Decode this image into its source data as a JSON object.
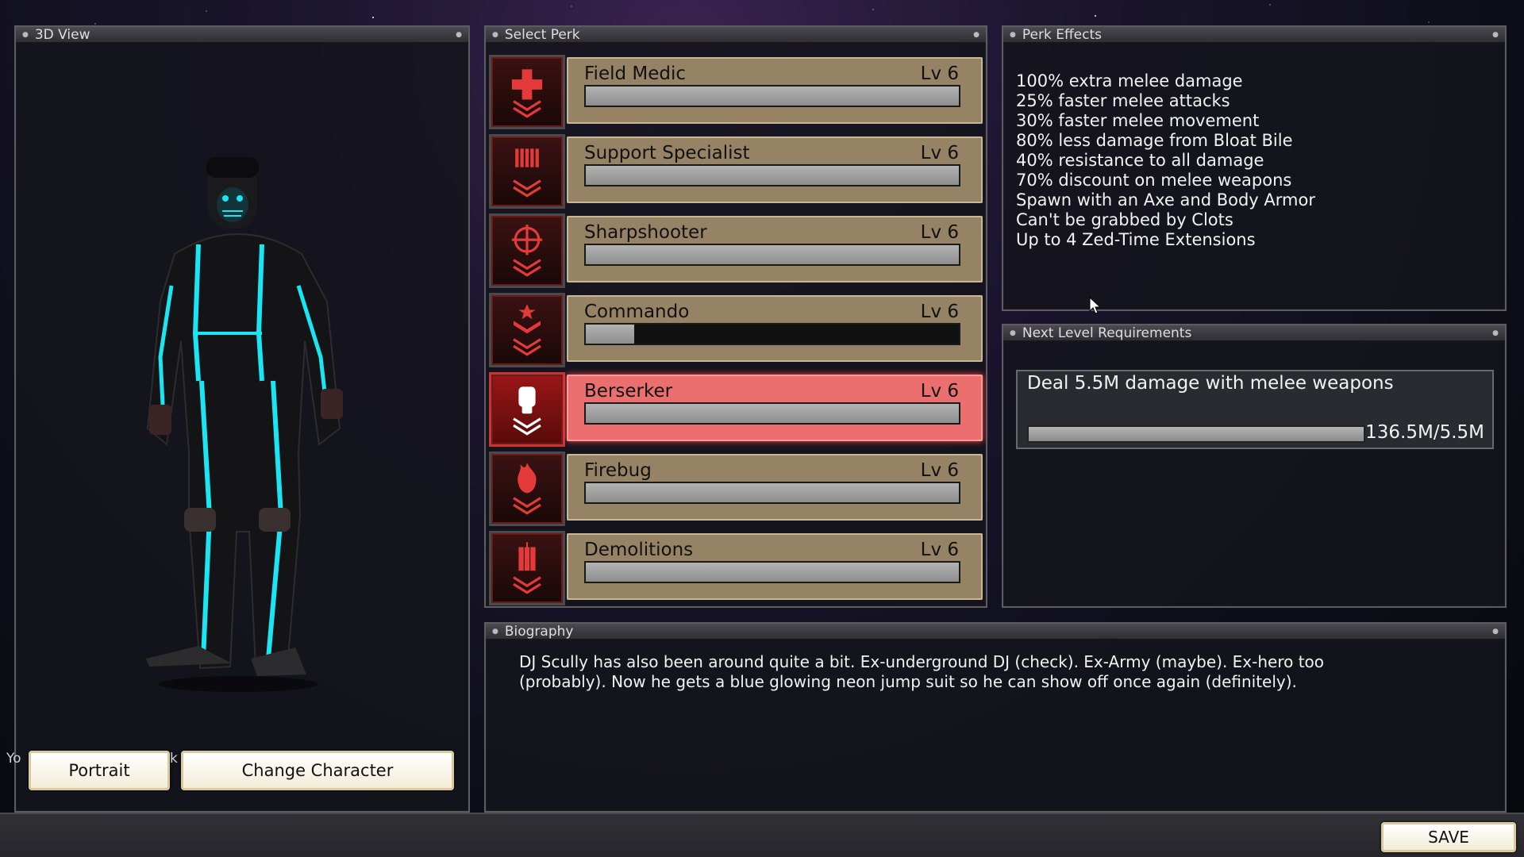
{
  "panels": {
    "view3d": "3D View",
    "select_perk": "Select Perk",
    "perk_effects": "Perk Effects",
    "next_level": "Next Level Requirements",
    "biography": "Biography"
  },
  "view3d": {
    "portrait_label": "Portrait",
    "change_character_label": "Change Character",
    "left_edge_text": "Yo",
    "mid_edge_text": "k"
  },
  "perks": [
    {
      "name": "Field Medic",
      "level": "Lv 6",
      "progress": 1.0,
      "icon": "medic-cross-icon",
      "selected": false
    },
    {
      "name": "Support Specialist",
      "level": "Lv 6",
      "progress": 1.0,
      "icon": "shells-icon",
      "selected": false
    },
    {
      "name": "Sharpshooter",
      "level": "Lv 6",
      "progress": 1.0,
      "icon": "crosshair-icon",
      "selected": false
    },
    {
      "name": "Commando",
      "level": "Lv 6",
      "progress": 0.13,
      "icon": "star-chevrons-icon",
      "selected": false
    },
    {
      "name": "Berserker",
      "level": "Lv 6",
      "progress": 1.0,
      "icon": "fist-icon",
      "selected": true
    },
    {
      "name": "Firebug",
      "level": "Lv 6",
      "progress": 1.0,
      "icon": "flame-icon",
      "selected": false
    },
    {
      "name": "Demolitions",
      "level": "Lv 6",
      "progress": 1.0,
      "icon": "dynamite-icon",
      "selected": false
    }
  ],
  "effects": [
    "100% extra melee damage",
    "25% faster melee attacks",
    "30% faster melee movement",
    "80% less damage from Bloat Bile",
    "40% resistance to all damage",
    "70% discount on melee weapons",
    "Spawn with an Axe and Body Armor",
    "Can't be grabbed by Clots",
    "Up to 4 Zed-Time Extensions"
  ],
  "requirement": {
    "text": "Deal 5.5M damage with melee weapons",
    "value": "136.5M/5.5M",
    "progress": 1.0
  },
  "biography": {
    "line1": "DJ Scully has also been around quite a bit. Ex-underground DJ (check). Ex-Army (maybe). Ex-hero too",
    "line2": "(probably). Now he gets a blue glowing neon jump suit so he can show off once again (definitely)."
  },
  "save_label": "SAVE",
  "colors": {
    "perk_bar": "#968366",
    "perk_selected": "#ec6f6f",
    "icon_red": "#e43a3a",
    "neon": "#19e6f2"
  }
}
